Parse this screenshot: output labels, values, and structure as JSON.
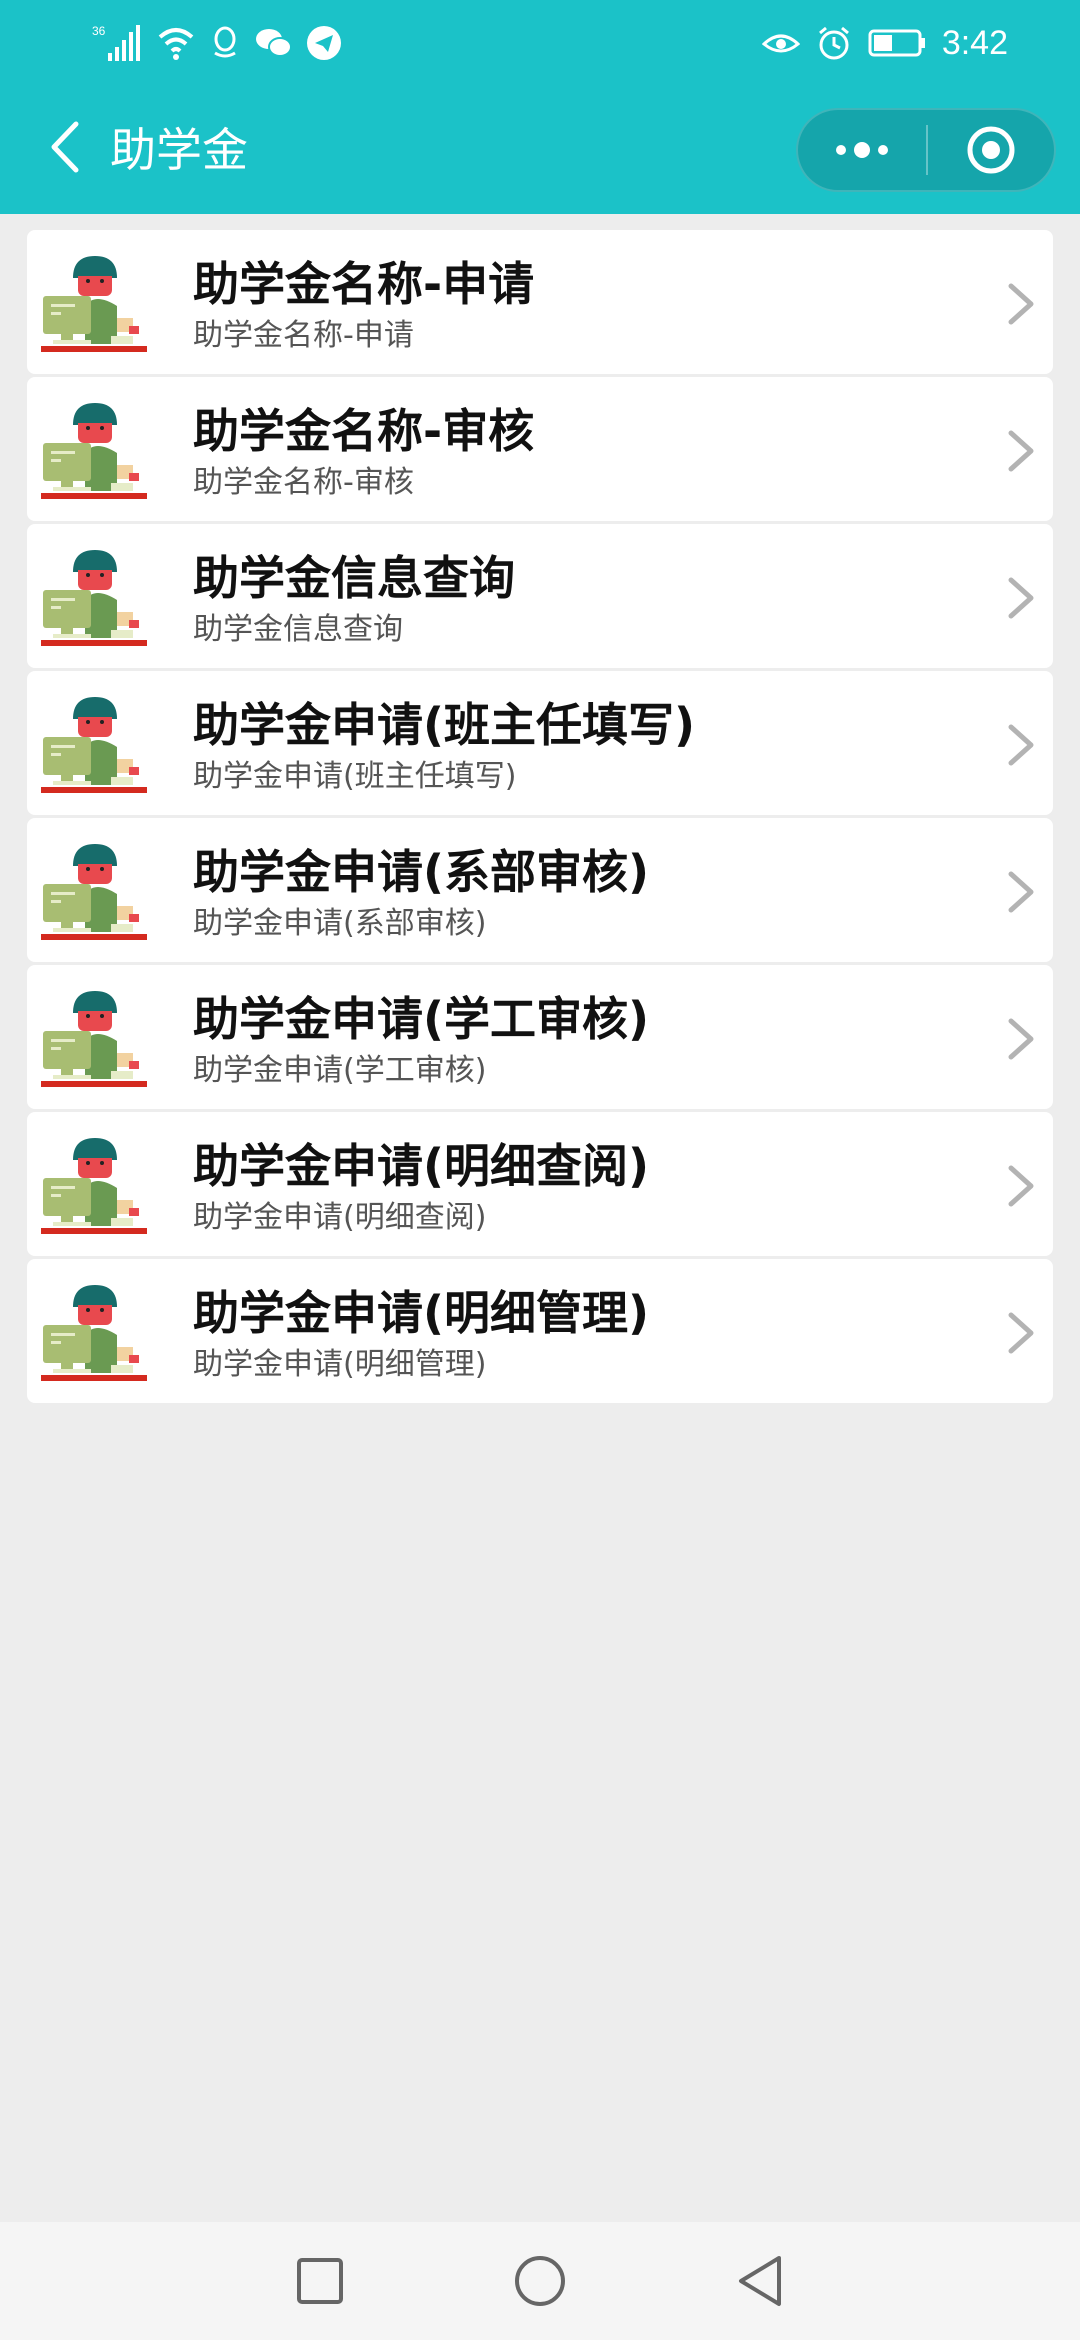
{
  "status_bar": {
    "network": "36",
    "time": "3:42",
    "left_icons": [
      "signal-icon",
      "wifi-icon",
      "qq-icon",
      "wechat-icon",
      "telegram-icon"
    ],
    "right_icons": [
      "eye-icon",
      "alarm-icon",
      "battery-icon"
    ]
  },
  "header": {
    "title": "助学金",
    "background": "#1bc2c8"
  },
  "list": {
    "items": [
      {
        "title": "助学金名称-申请",
        "subtitle": "助学金名称-申请"
      },
      {
        "title": "助学金名称-审核",
        "subtitle": "助学金名称-审核"
      },
      {
        "title": "助学金信息查询",
        "subtitle": "助学金信息查询"
      },
      {
        "title": "助学金申请(班主任填写)",
        "subtitle": "助学金申请(班主任填写)"
      },
      {
        "title": "助学金申请(系部审核)",
        "subtitle": "助学金申请(系部审核)"
      },
      {
        "title": "助学金申请(学工审核)",
        "subtitle": "助学金申请(学工审核)"
      },
      {
        "title": "助学金申请(明细查阅)",
        "subtitle": "助学金申请(明细查阅)"
      },
      {
        "title": "助学金申请(明细管理)",
        "subtitle": "助学金申请(明细管理)"
      }
    ]
  },
  "system_nav": {
    "buttons": [
      "recents-square-icon",
      "home-circle-icon",
      "back-triangle-icon"
    ]
  }
}
